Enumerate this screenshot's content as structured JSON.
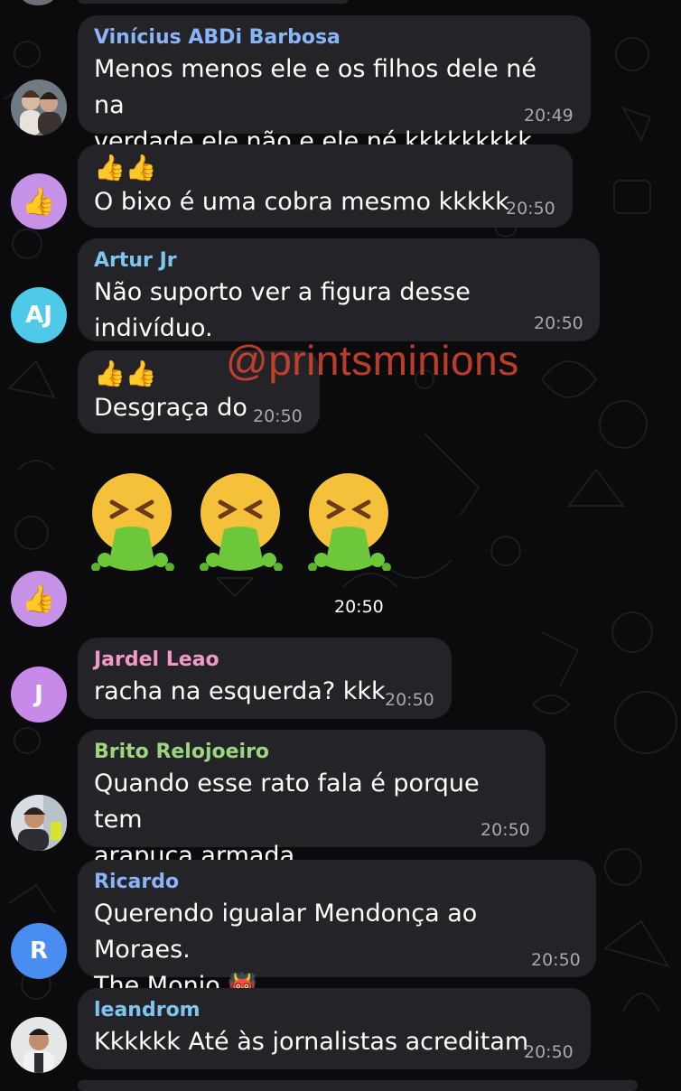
{
  "watermark": "@printsminions",
  "colors": {
    "background": "#0b0b0d",
    "bubble": "#242428",
    "timestamp": "#a7a7ad",
    "watermark": "#d9462e"
  },
  "messages": [
    {
      "sender": "Vinícius ABDi Barbosa",
      "sender_color": "#8ab4f8",
      "lines": [
        "Menos menos ele e os filhos dele né na",
        "verdade ele não e ele né kkkkkkkkk"
      ],
      "time": "20:49",
      "avatar": "photo-couple"
    },
    {
      "emoji_line": "👍👍",
      "lines": [
        "O bixo é uma cobra mesmo kkkkk"
      ],
      "time": "20:50",
      "avatar": "thumbs-up"
    },
    {
      "sender": "Artur Jr",
      "sender_color": "#7ec6f0",
      "lines": [
        "Não suporto ver a figura desse indivíduo."
      ],
      "time": "20:50",
      "avatar_initials": "AJ"
    },
    {
      "emoji_line": "👍👍",
      "lines": [
        "Desgraça do"
      ],
      "time": "20:50"
    },
    {
      "big_emoji": [
        "🤮",
        "🤮",
        "🤮"
      ],
      "time": "20:50",
      "avatar": "thumbs-up"
    },
    {
      "sender": "Jardel Leao",
      "sender_color": "#f29ac7",
      "lines": [
        "racha na esquerda? kkk"
      ],
      "time": "20:50",
      "avatar_initials": "J"
    },
    {
      "sender": "Brito Relojoeiro",
      "sender_color": "#9cd67f",
      "lines": [
        "Quando esse rato fala é porque tem",
        "arapuca armada"
      ],
      "time": "20:50",
      "avatar": "photo-man"
    },
    {
      "sender": "Ricardo",
      "sender_color": "#8ab4f8",
      "lines": [
        "Querendo igualar Mendonça ao Moraes.",
        "The Monio"
      ],
      "emoji_suffix": "👹",
      "time": "20:50",
      "avatar_initials": "R"
    },
    {
      "sender": "leandrom",
      "sender_color": "#7ec6f0",
      "lines": [
        "Kkkkkk Até às jornalistas acreditam"
      ],
      "time": "20:50",
      "avatar": "photo-man2"
    }
  ]
}
